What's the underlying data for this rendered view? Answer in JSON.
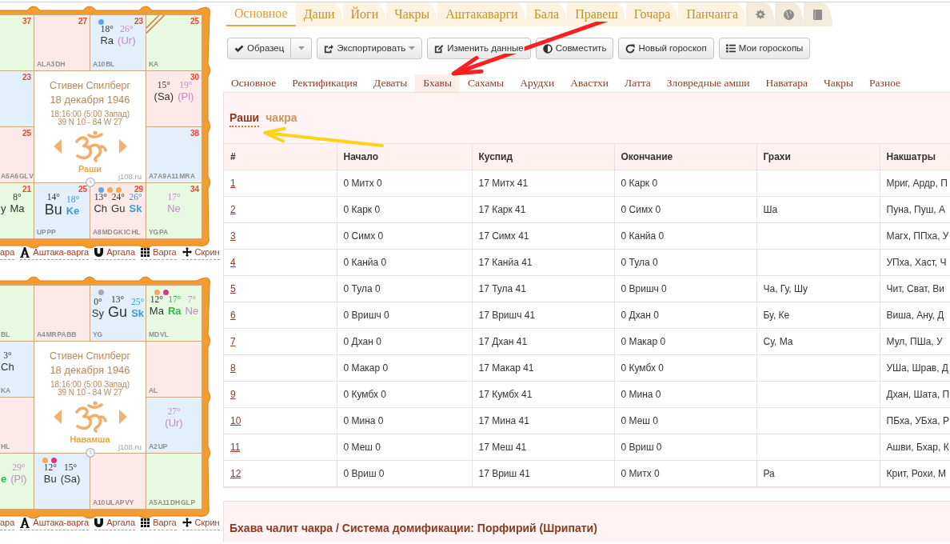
{
  "charts": [
    {
      "houses": [
        {
          "color": "#e7f9e1",
          "number": "37",
          "ascendant": false
        },
        {
          "color": "#fde9e7",
          "number": "27",
          "ascendant": false,
          "label": "AL A3 DH"
        },
        {
          "color": "#e3f0fb",
          "number": "23",
          "ascendant": false,
          "dots": [
            {
              "color": "#5aa8e8"
            }
          ],
          "planets": [
            {
              "degree": "18°",
              "name": "Ra",
              "color": "#333333",
              "bold": false,
              "large": false
            },
            {
              "degree": "26°",
              "name": "(Ur)",
              "color": "#c48bc9",
              "bold": false,
              "large": false
            }
          ],
          "label": "A10 BL"
        },
        {
          "color": "#e7f9e1",
          "number": "25",
          "ascendant": true,
          "label": "KA"
        },
        {
          "color": "#e3f0fb",
          "number": "23",
          "ascendant": false
        },
        {
          "color": "#fde9e7",
          "number": "30",
          "ascendant": false,
          "planets": [
            {
              "degree": "15°",
              "name": "(Sa)",
              "color": "#333333",
              "bold": false,
              "large": false
            },
            {
              "degree": "19°",
              "name": "(Pl)",
              "color": "#c48bc9",
              "bold": false,
              "large": false
            }
          ]
        },
        {
          "color": "#fde9e7",
          "number": "25",
          "ascendant": false,
          "label": "A5 A6 GL V"
        },
        {
          "color": "#e3f0fb",
          "number": "38",
          "ascendant": false,
          "label": "A7 A9 A11 MR A"
        },
        {
          "color": "#e7f9e1",
          "number": "21",
          "ascendant": false,
          "planets": [
            {
              "name": "y",
              "color": "#333333",
              "bold": false,
              "large": false
            },
            {
              "degree": "8°",
              "name": "Ma",
              "color": "#333333",
              "bold": false,
              "large": false
            }
          ]
        },
        {
          "color": "#e3f0fb",
          "number": "25",
          "ascendant": false,
          "planets": [
            {
              "degree": "14°",
              "name": "Bu",
              "color": "#333333",
              "bold": false,
              "large": true
            },
            {
              "degree": "18°",
              "name": "Ke",
              "color": "#3e9bd4",
              "bold": true,
              "large": false
            }
          ],
          "label": "UP PP"
        },
        {
          "color": "#fde9e7",
          "number": "29",
          "ascendant": false,
          "dots": [
            {
              "color": "#5aa8e8"
            },
            {
              "color": "#f5a75a"
            },
            {
              "color": "#f5a75a"
            }
          ],
          "planets": [
            {
              "degree": "13°",
              "name": "Ch",
              "color": "#333333",
              "bold": false,
              "large": false
            },
            {
              "degree": "24°",
              "name": "Gu",
              "color": "#333333",
              "bold": false,
              "large": false
            },
            {
              "degree": "26°",
              "name": "Sk",
              "color": "#3e9bd4",
              "bold": true,
              "large": false
            }
          ],
          "label": "A8 MD GK IC HL"
        },
        {
          "color": "#e7f9e1",
          "number": "34",
          "ascendant": false,
          "planets": [
            {
              "degree": "17°",
              "name": "Ne",
              "color": "#c48bc9",
              "bold": false,
              "large": false
            }
          ],
          "label": "YG PA"
        }
      ],
      "name": "Стивен Спилберг",
      "date": "18 декабря 1946",
      "time": "18:16:00 (5:00 Запад)",
      "coordinates": "39 N 10 - 84 W 27",
      "chart_label": "Раши",
      "site": "j108.ru",
      "links": [
        {
          "label": "ара"
        },
        {
          "label": "Аштака-варга"
        },
        {
          "label": "Аргала"
        },
        {
          "label": "Варга"
        },
        {
          "label": "Скрин"
        }
      ]
    },
    {
      "houses": [
        {
          "color": "#e7f9e1",
          "ascendant": false,
          "label": "BL"
        },
        {
          "color": "#fde9e7",
          "ascendant": false,
          "label": "A4 MR PA BB"
        },
        {
          "color": "#e3f0fb",
          "ascendant": false,
          "dots": [
            {
              "color": "#a8a8a8"
            }
          ],
          "planets": [
            {
              "degree": "0°",
              "name": "Sy",
              "color": "#333333",
              "bold": false,
              "large": false
            },
            {
              "degree": "13°",
              "name": "Gu",
              "color": "#333333",
              "bold": false,
              "large": true
            },
            {
              "degree": "25°",
              "name": "Sk",
              "color": "#3e9bd4",
              "bold": true,
              "large": false
            }
          ],
          "label": "YG"
        },
        {
          "color": "#e7f9e1",
          "ascendant": false,
          "dots": [
            {
              "color": "#f5a75a"
            },
            {
              "color": "#d23a86"
            }
          ],
          "planets": [
            {
              "degree": "12°",
              "name": "Ma",
              "color": "#333333",
              "bold": false,
              "large": false
            },
            {
              "degree": "17°",
              "name": "Ra",
              "color": "#2eb84b",
              "bold": true,
              "large": false
            },
            {
              "degree": "7°",
              "name": "Ne",
              "color": "#c48bc9",
              "bold": false,
              "large": false
            }
          ],
          "label": "MD VL"
        },
        {
          "color": "#e3f0fb",
          "ascendant": false,
          "planets": [
            {
              "degree": "3°",
              "name": "Ch",
              "color": "#333333",
              "bold": false,
              "large": false
            }
          ],
          "label": "KA"
        },
        {
          "color": "#fde9e7",
          "ascendant": false,
          "label": "AL"
        },
        {
          "color": "#fde9e7",
          "ascendant": false,
          "label": "HL"
        },
        {
          "color": "#e3f0fb",
          "ascendant": false,
          "planets": [
            {
              "degree": "27°",
              "name": "(Ur)",
              "color": "#c48bc9",
              "bold": false,
              "large": false
            }
          ],
          "label": "A2 UP"
        },
        {
          "color": "#e7f9e1",
          "ascendant": false,
          "planets": [
            {
              "name": "e",
              "color": "#2eb84b",
              "bold": true,
              "large": false
            },
            {
              "degree": "29°",
              "name": "(Pl)",
              "color": "#c48bc9",
              "bold": false,
              "large": false
            }
          ]
        },
        {
          "color": "#e3f0fb",
          "ascendant": false,
          "dots": [
            {
              "color": "#f5a75a"
            },
            {
              "color": "#d23a86"
            }
          ],
          "planets": [
            {
              "degree": "12°",
              "name": "Bu",
              "color": "#333333",
              "bold": false,
              "large": false
            },
            {
              "degree": "15°",
              "name": "(Sa)",
              "color": "#333333",
              "bold": false,
              "large": false
            }
          ]
        },
        {
          "color": "#fde9e7",
          "ascendant": false,
          "label": "A10 UL AP VY"
        },
        {
          "color": "#e7f9e1",
          "ascendant": false,
          "label": "A5 A11 DH GL P"
        }
      ],
      "name": "Стивен Спилберг",
      "date": "18 декабря 1946",
      "time": "18:16:00 (5:00 Запад)",
      "coordinates": "39 N 10 - 84 W 27",
      "chart_label": "Навамша",
      "site": "j108.ru",
      "links": [
        {
          "label": "ара"
        },
        {
          "label": "Аштака-варга"
        },
        {
          "label": "Аргала"
        },
        {
          "label": "Варга"
        },
        {
          "label": "Скрин"
        }
      ]
    }
  ],
  "tabs": [
    {
      "label": "Основное",
      "selected": true
    },
    {
      "label": "Даши",
      "selected": false
    },
    {
      "label": "Йоги",
      "selected": false
    },
    {
      "label": "Чакры",
      "selected": false
    },
    {
      "label": "Аштакаварги",
      "selected": false
    },
    {
      "label": "Бала",
      "selected": false
    },
    {
      "label": "Правеш",
      "selected": false
    },
    {
      "label": "Гочара",
      "selected": false
    },
    {
      "label": "Панчанга",
      "selected": false
    }
  ],
  "icon_tabs": [
    {
      "selected": false
    },
    {
      "selected": false
    },
    {
      "selected": false
    }
  ],
  "toolbar": [
    {
      "label": "Образец",
      "kind": "split"
    },
    {
      "label": "Экспортировать",
      "kind": "dropdown"
    },
    {
      "label": "Изменить данные",
      "kind": "plain"
    },
    {
      "label": "Совместить",
      "kind": "plain"
    },
    {
      "label": "Новый гороскоп",
      "kind": "plain"
    },
    {
      "label": "Мои гороскопы",
      "kind": "plain"
    }
  ],
  "section_tabs": [
    {
      "label": "Основное",
      "selected": false
    },
    {
      "label": "Ректификация",
      "selected": false
    },
    {
      "label": "Деваты",
      "selected": false
    },
    {
      "label": "Бхавы",
      "selected": true
    },
    {
      "label": "Сахамы",
      "selected": false
    },
    {
      "label": "Арудхи",
      "selected": false
    },
    {
      "label": "Авастхи",
      "selected": false
    },
    {
      "label": "Латта",
      "selected": false
    },
    {
      "label": "Зловредные амши",
      "selected": false
    },
    {
      "label": "Наватара",
      "selected": false
    },
    {
      "label": "Чакры",
      "selected": false
    },
    {
      "label": "Разное",
      "selected": false
    }
  ],
  "bhava": {
    "views": [
      {
        "label": "Раши",
        "selected": true
      },
      {
        "label": "чакра",
        "selected": false
      }
    ],
    "table": {
      "columns": [
        "#",
        "Начало",
        "Куспид",
        "Окончание",
        "Грахи",
        "Накшатры"
      ],
      "rows": [
        {
          "number": "1",
          "start": "0 Митх 0",
          "cusp": "17 Митх 41",
          "end": "0 Карк 0",
          "nakshatras": "Мриг, Ардр, П"
        },
        {
          "number": "2",
          "start": "0 Карк 0",
          "cusp": "17 Карк 41",
          "end": "0 Симх 0",
          "planets": "Ша",
          "nakshatras": "Пуна, Пуш, А"
        },
        {
          "number": "3",
          "start": "0 Симх 0",
          "cusp": "17 Симх 41",
          "end": "0 Канйа 0",
          "nakshatras": "Магх, ППха, У"
        },
        {
          "number": "4",
          "start": "0 Канйа 0",
          "cusp": "17 Канйа 41",
          "end": "0 Тула 0",
          "nakshatras": "УПха, Хаст, Ч"
        },
        {
          "number": "5",
          "start": "0 Тула 0",
          "cusp": "17 Тула 41",
          "end": "0 Вришч 0",
          "planets": "Ча, Гу, Шу",
          "nakshatras": "Чит, Сват, Ви"
        },
        {
          "number": "6",
          "start": "0 Вришч 0",
          "cusp": "17 Вришч 41",
          "end": "0 Дхан 0",
          "planets": "Бу, Ке",
          "nakshatras": "Виша, Ану, Д"
        },
        {
          "number": "7",
          "start": "0 Дхан 0",
          "cusp": "17 Дхан 41",
          "end": "0 Макар 0",
          "planets": "Су, Ма",
          "nakshatras": "Мул, ПШа, У"
        },
        {
          "number": "8",
          "start": "0 Макар 0",
          "cusp": "17 Макар 41",
          "end": "0 Кумбх 0",
          "nakshatras": "УШа, Шрав, Д"
        },
        {
          "number": "9",
          "start": "0 Кумбх 0",
          "cusp": "17 Кумбх 41",
          "end": "0 Мина 0",
          "nakshatras": "Дхан, Шата, П"
        },
        {
          "number": "10",
          "start": "0 Мина 0",
          "cusp": "17 Мина 41",
          "end": "0 Меш 0",
          "nakshatras": "ПБха, УБха, Р"
        },
        {
          "number": "11",
          "start": "0 Меш 0",
          "cusp": "17 Меш 41",
          "end": "0 Вриш 0",
          "nakshatras": "Ашви, Бхар, К"
        },
        {
          "number": "12",
          "start": "0 Вриш 0",
          "cusp": "17 Вриш 41",
          "end": "0 Митх 0",
          "planets": "Ра",
          "nakshatras": "Крит, Рохи, М"
        }
      ]
    }
  },
  "chalit": {
    "title": "Бхава чалит чакра / Система домификации: Порфирий (Шрипати)"
  },
  "annotations": [
    {
      "kind": "arrow",
      "color": "#ff1f1f"
    },
    {
      "kind": "arrow",
      "color": "#ffd21a"
    }
  ]
}
